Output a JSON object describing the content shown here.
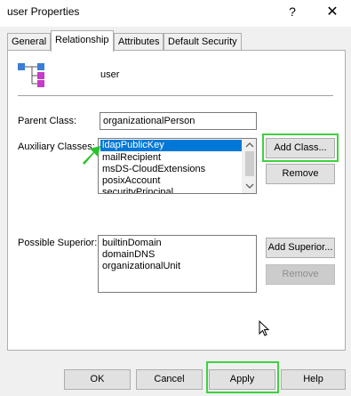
{
  "window": {
    "title": "user Properties",
    "help_glyph": "?",
    "close_glyph": "✕"
  },
  "tabs": [
    {
      "label": "General"
    },
    {
      "label": "Relationship"
    },
    {
      "label": "Attributes"
    },
    {
      "label": "Default Security"
    }
  ],
  "header": {
    "icon": "class-hierarchy-icon",
    "name": "user"
  },
  "parent_class": {
    "label": "Parent Class:",
    "value": "organizationalPerson"
  },
  "auxiliary": {
    "label": "Auxiliary Classes:",
    "items": [
      "ldapPublicKey",
      "mailRecipient",
      "msDS-CloudExtensions",
      "posixAccount",
      "securityPrincipal"
    ],
    "selected_index": 0,
    "add_label": "Add Class...",
    "remove_label": "Remove"
  },
  "possible_superior": {
    "label": "Possible Superior:",
    "items": [
      "builtinDomain",
      "domainDNS",
      "organizationalUnit"
    ],
    "add_label": "Add Superior...",
    "remove_label": "Remove"
  },
  "footer": {
    "ok": "OK",
    "cancel": "Cancel",
    "apply": "Apply",
    "help": "Help"
  },
  "colors": {
    "highlight": "#3fd13f",
    "selection": "#0078d7"
  }
}
